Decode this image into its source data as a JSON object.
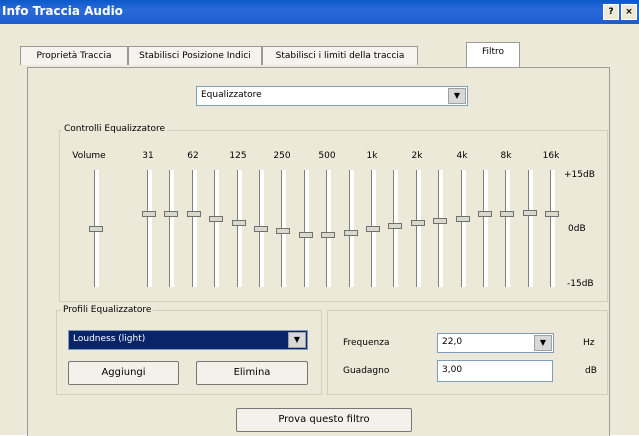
{
  "window": {
    "title": "Info Traccia Audio",
    "help_glyph": "?",
    "close_glyph": "×"
  },
  "tabs": [
    {
      "label": "Proprietà Traccia"
    },
    {
      "label": "Stabilisci Posizione Indici"
    },
    {
      "label": "Stabilisci i limiti della traccia"
    },
    {
      "label": "Filtro"
    }
  ],
  "filter_select": {
    "value": "Equalizzatore",
    "arrow": "▼"
  },
  "equalizer": {
    "group_label": "Controlli Equalizzatore",
    "volume_label": "Volume",
    "volume_level": 0.5,
    "bands": [
      {
        "label": "31",
        "level": 0.37
      },
      {
        "label": "",
        "level": 0.37
      },
      {
        "label": "62",
        "level": 0.37
      },
      {
        "label": "",
        "level": 0.41
      },
      {
        "label": "125",
        "level": 0.45
      },
      {
        "label": "",
        "level": 0.5
      },
      {
        "label": "250",
        "level": 0.52
      },
      {
        "label": "",
        "level": 0.56
      },
      {
        "label": "500",
        "level": 0.56
      },
      {
        "label": "",
        "level": 0.54
      },
      {
        "label": "1k",
        "level": 0.5
      },
      {
        "label": "",
        "level": 0.48
      },
      {
        "label": "2k",
        "level": 0.45
      },
      {
        "label": "",
        "level": 0.43
      },
      {
        "label": "4k",
        "level": 0.41
      },
      {
        "label": "",
        "level": 0.37
      },
      {
        "label": "8k",
        "level": 0.37
      },
      {
        "label": "",
        "level": 0.36
      },
      {
        "label": "16k",
        "level": 0.37
      }
    ],
    "db_max": "+15dB",
    "db_mid": "0dB",
    "db_min": "-15dB"
  },
  "profiles": {
    "group_label": "Profili Equalizzatore",
    "selected": "Loudness (light)",
    "arrow": "▼",
    "add_label": "Aggiungi",
    "delete_label": "Elimina"
  },
  "params": {
    "frequency_label": "Frequenza",
    "frequency_value": "22,0",
    "frequency_arrow": "▼",
    "frequency_unit": "Hz",
    "gain_label": "Guadagno",
    "gain_value": "3,00",
    "gain_unit": "dB"
  },
  "try_button": "Prova questo filtro"
}
